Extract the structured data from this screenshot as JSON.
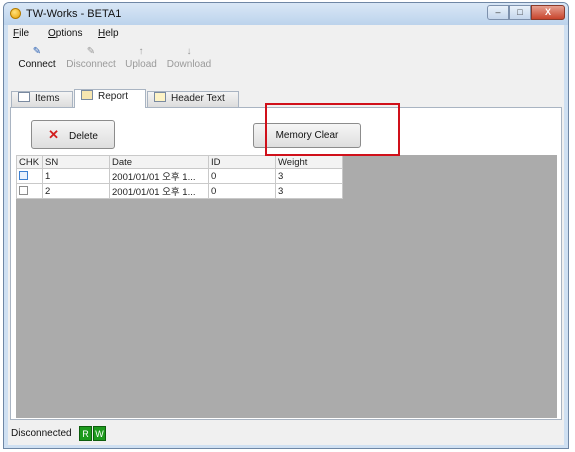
{
  "window": {
    "title": "TW-Works - BETA1",
    "controls": {
      "minimize": "–",
      "maximize": "□",
      "close": "X"
    }
  },
  "menu": [
    {
      "first": "F",
      "rest": "ile"
    },
    {
      "first": "O",
      "rest": "ptions"
    },
    {
      "first": "H",
      "rest": "elp"
    }
  ],
  "toolbar": {
    "connect": "Connect",
    "disconnect": "Disconnect",
    "upload": "Upload",
    "download": "Download",
    "connect_icon": "✎",
    "disconnect_icon": "✎",
    "upload_icon": "↑",
    "download_icon": "↓"
  },
  "tabs": {
    "items": "Items",
    "report": "Report",
    "header_text": "Header Text"
  },
  "report": {
    "delete_label": "Delete",
    "delete_icon": "✕",
    "memory_clear_label": "Memory Clear",
    "columns": [
      "CHK",
      "SN",
      "Date",
      "ID",
      "Weight"
    ],
    "rows": [
      {
        "sn": "1",
        "date": "2001/01/01 오후 1...",
        "id": "0",
        "weight": "3"
      },
      {
        "sn": "2",
        "date": "2001/01/01 오후 1...",
        "id": "0",
        "weight": "3"
      }
    ]
  },
  "status": {
    "text": "Disconnected",
    "read_led": "R",
    "write_led": "W"
  },
  "colors": {
    "highlight": "#d0101a",
    "led": "#1d9a1d",
    "grid_background": "#ababab"
  }
}
